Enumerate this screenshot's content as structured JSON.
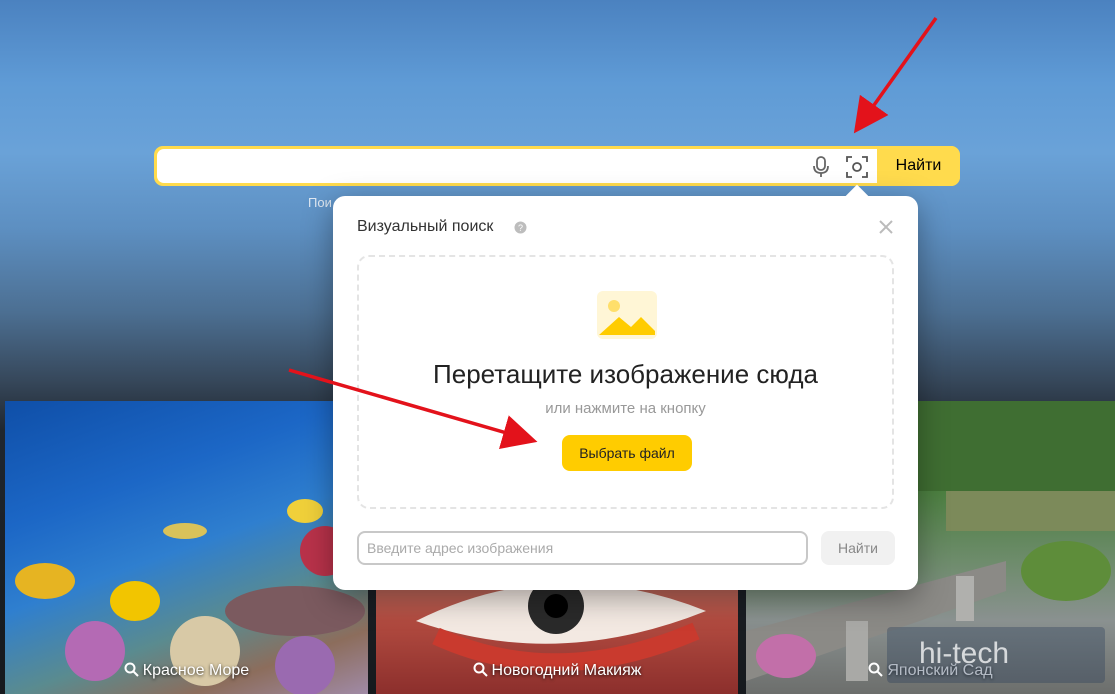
{
  "search": {
    "value": "",
    "button_label": "Найти",
    "hint_partial": "Пои",
    "mic_icon": "microphone-icon",
    "camera_icon": "visual-search-camera-icon"
  },
  "popup": {
    "title": "Визуальный поиск",
    "help_icon": "question-icon",
    "close_icon": "close-icon",
    "drop_title": "Перетащите изображение сюда",
    "drop_subtitle": "или нажмите на кнопку",
    "choose_button": "Выбрать файл",
    "url_placeholder": "Введите адрес изображения",
    "url_button": "Найти"
  },
  "tiles": [
    {
      "label": "Красное Море"
    },
    {
      "label": "Новогодний Макияж"
    },
    {
      "label": "Японский Сад"
    }
  ],
  "watermark": {
    "text": "hi-tech"
  },
  "colors": {
    "accent": "#ffdb4d",
    "button": "#ffcc00",
    "annotation_arrow": "#e3121b"
  }
}
